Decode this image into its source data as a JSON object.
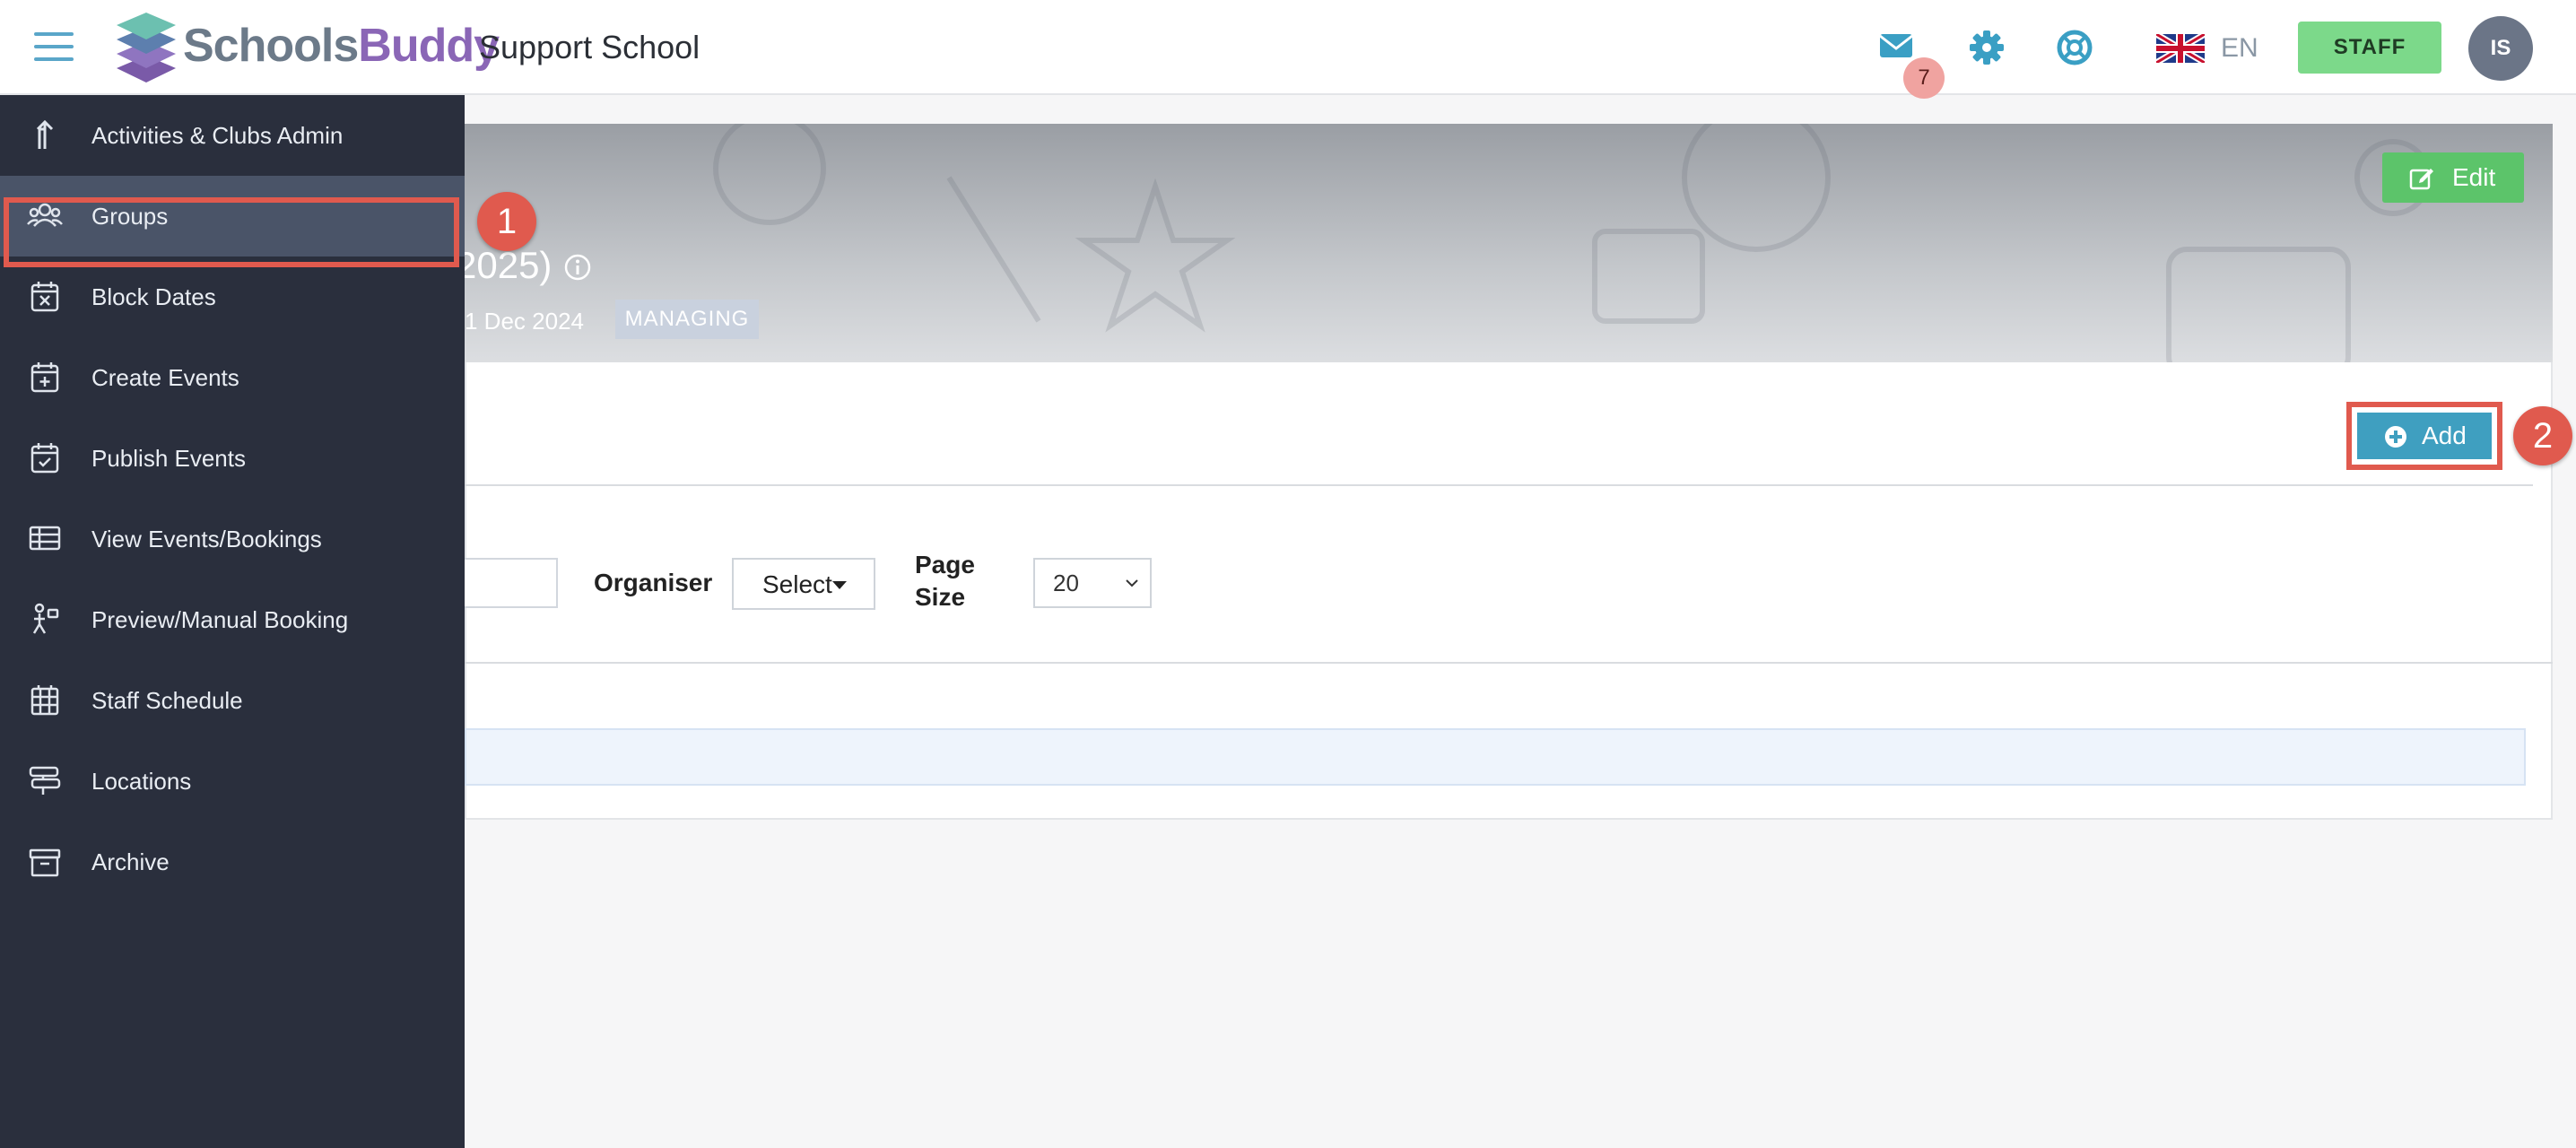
{
  "header": {
    "logo_part1": "Schools",
    "logo_part2": "Buddy",
    "school_name": "Support School",
    "mail_badge": "7",
    "language": "EN",
    "staff_label": "STAFF",
    "avatar_initials": "IS",
    "colors": {
      "accent": "#3f9fc0",
      "staff": "#7cd98a",
      "badge": "#f0a3a0"
    }
  },
  "sidebar": {
    "items": [
      {
        "label": "Activities & Clubs Admin",
        "icon": "arrow-up-icon"
      },
      {
        "label": "Groups",
        "icon": "people-icon"
      },
      {
        "label": "Block Dates",
        "icon": "calendar-x-icon"
      },
      {
        "label": "Create Events",
        "icon": "calendar-plus-icon"
      },
      {
        "label": "Publish Events",
        "icon": "calendar-check-icon"
      },
      {
        "label": "View Events/Bookings",
        "icon": "table-icon"
      },
      {
        "label": "Preview/Manual Booking",
        "icon": "person-booking-icon"
      },
      {
        "label": "Staff Schedule",
        "icon": "grid-calendar-icon"
      },
      {
        "label": "Locations",
        "icon": "signpost-icon"
      },
      {
        "label": "Archive",
        "icon": "archive-icon"
      }
    ],
    "active": "Groups"
  },
  "banner": {
    "title_fragment": "2025)",
    "date_fragment": "1 Dec 2024",
    "status": "MANAGING",
    "edit_label": "Edit"
  },
  "actions": {
    "add_label": "Add"
  },
  "filters": {
    "organiser_label": "Organiser",
    "organiser_value": "Select",
    "page_size_label": "Page Size",
    "page_size_value": "20"
  },
  "callouts": {
    "first": "1",
    "second": "2"
  }
}
